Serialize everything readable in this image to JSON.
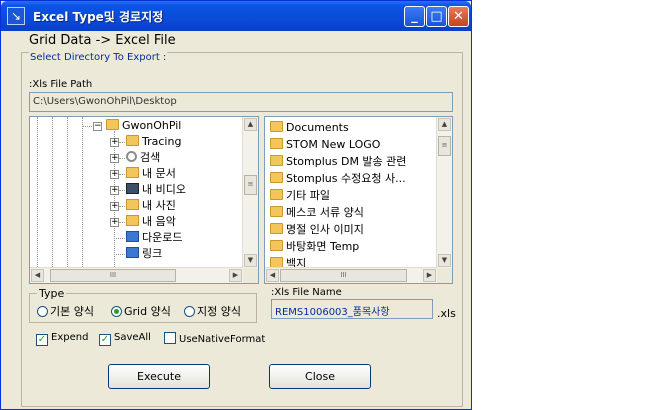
{
  "window": {
    "title": "Excel Type및 경로지정",
    "header": "Grid Data -> Excel File"
  },
  "colors": {
    "titlebar": "#0b54e6",
    "accent_text": "#0a2a9c",
    "check": "#21a121"
  },
  "export_group": {
    "label": "Select Directory To Export :"
  },
  "path": {
    "label": ":Xls File Path",
    "value": "C:\\Users\\GwonOhPil\\Desktop"
  },
  "tree": {
    "items": [
      {
        "label": "GwonOhPil",
        "icon": "folder-icon"
      },
      {
        "label": "Tracing",
        "icon": "folder-icon"
      },
      {
        "label": "검색",
        "icon": "search-folder-icon"
      },
      {
        "label": "내 문서",
        "icon": "documents-folder-icon"
      },
      {
        "label": "내 비디오",
        "icon": "video-folder-icon"
      },
      {
        "label": "내 사진",
        "icon": "pictures-folder-icon"
      },
      {
        "label": "내 음악",
        "icon": "music-folder-icon"
      },
      {
        "label": "다운로드",
        "icon": "download-folder-icon"
      },
      {
        "label": "링크",
        "icon": "links-folder-icon"
      }
    ]
  },
  "files": {
    "items": [
      "Documents",
      "STOM New LOGO",
      "Stomplus DM 발송 관련",
      "Stomplus 수정요청 사...",
      "기타 파일",
      "메스코 서류 양식",
      "명절 인사 이미지",
      "바탕화면 Temp",
      "백지"
    ]
  },
  "type": {
    "label": "Type",
    "options": [
      "기본 양식",
      "Grid 양식",
      "지정 양식"
    ],
    "selected": "Grid 양식"
  },
  "filename": {
    "label": ":Xls File Name",
    "value": "REMS1006003_품목사항",
    "ext": ".xls"
  },
  "options": [
    {
      "label": "Expend",
      "checked": true
    },
    {
      "label": "SaveAll",
      "checked": true
    },
    {
      "label": "UseNativeFormat",
      "checked": false
    }
  ],
  "buttons": {
    "execute": "Execute",
    "close": "Close"
  }
}
